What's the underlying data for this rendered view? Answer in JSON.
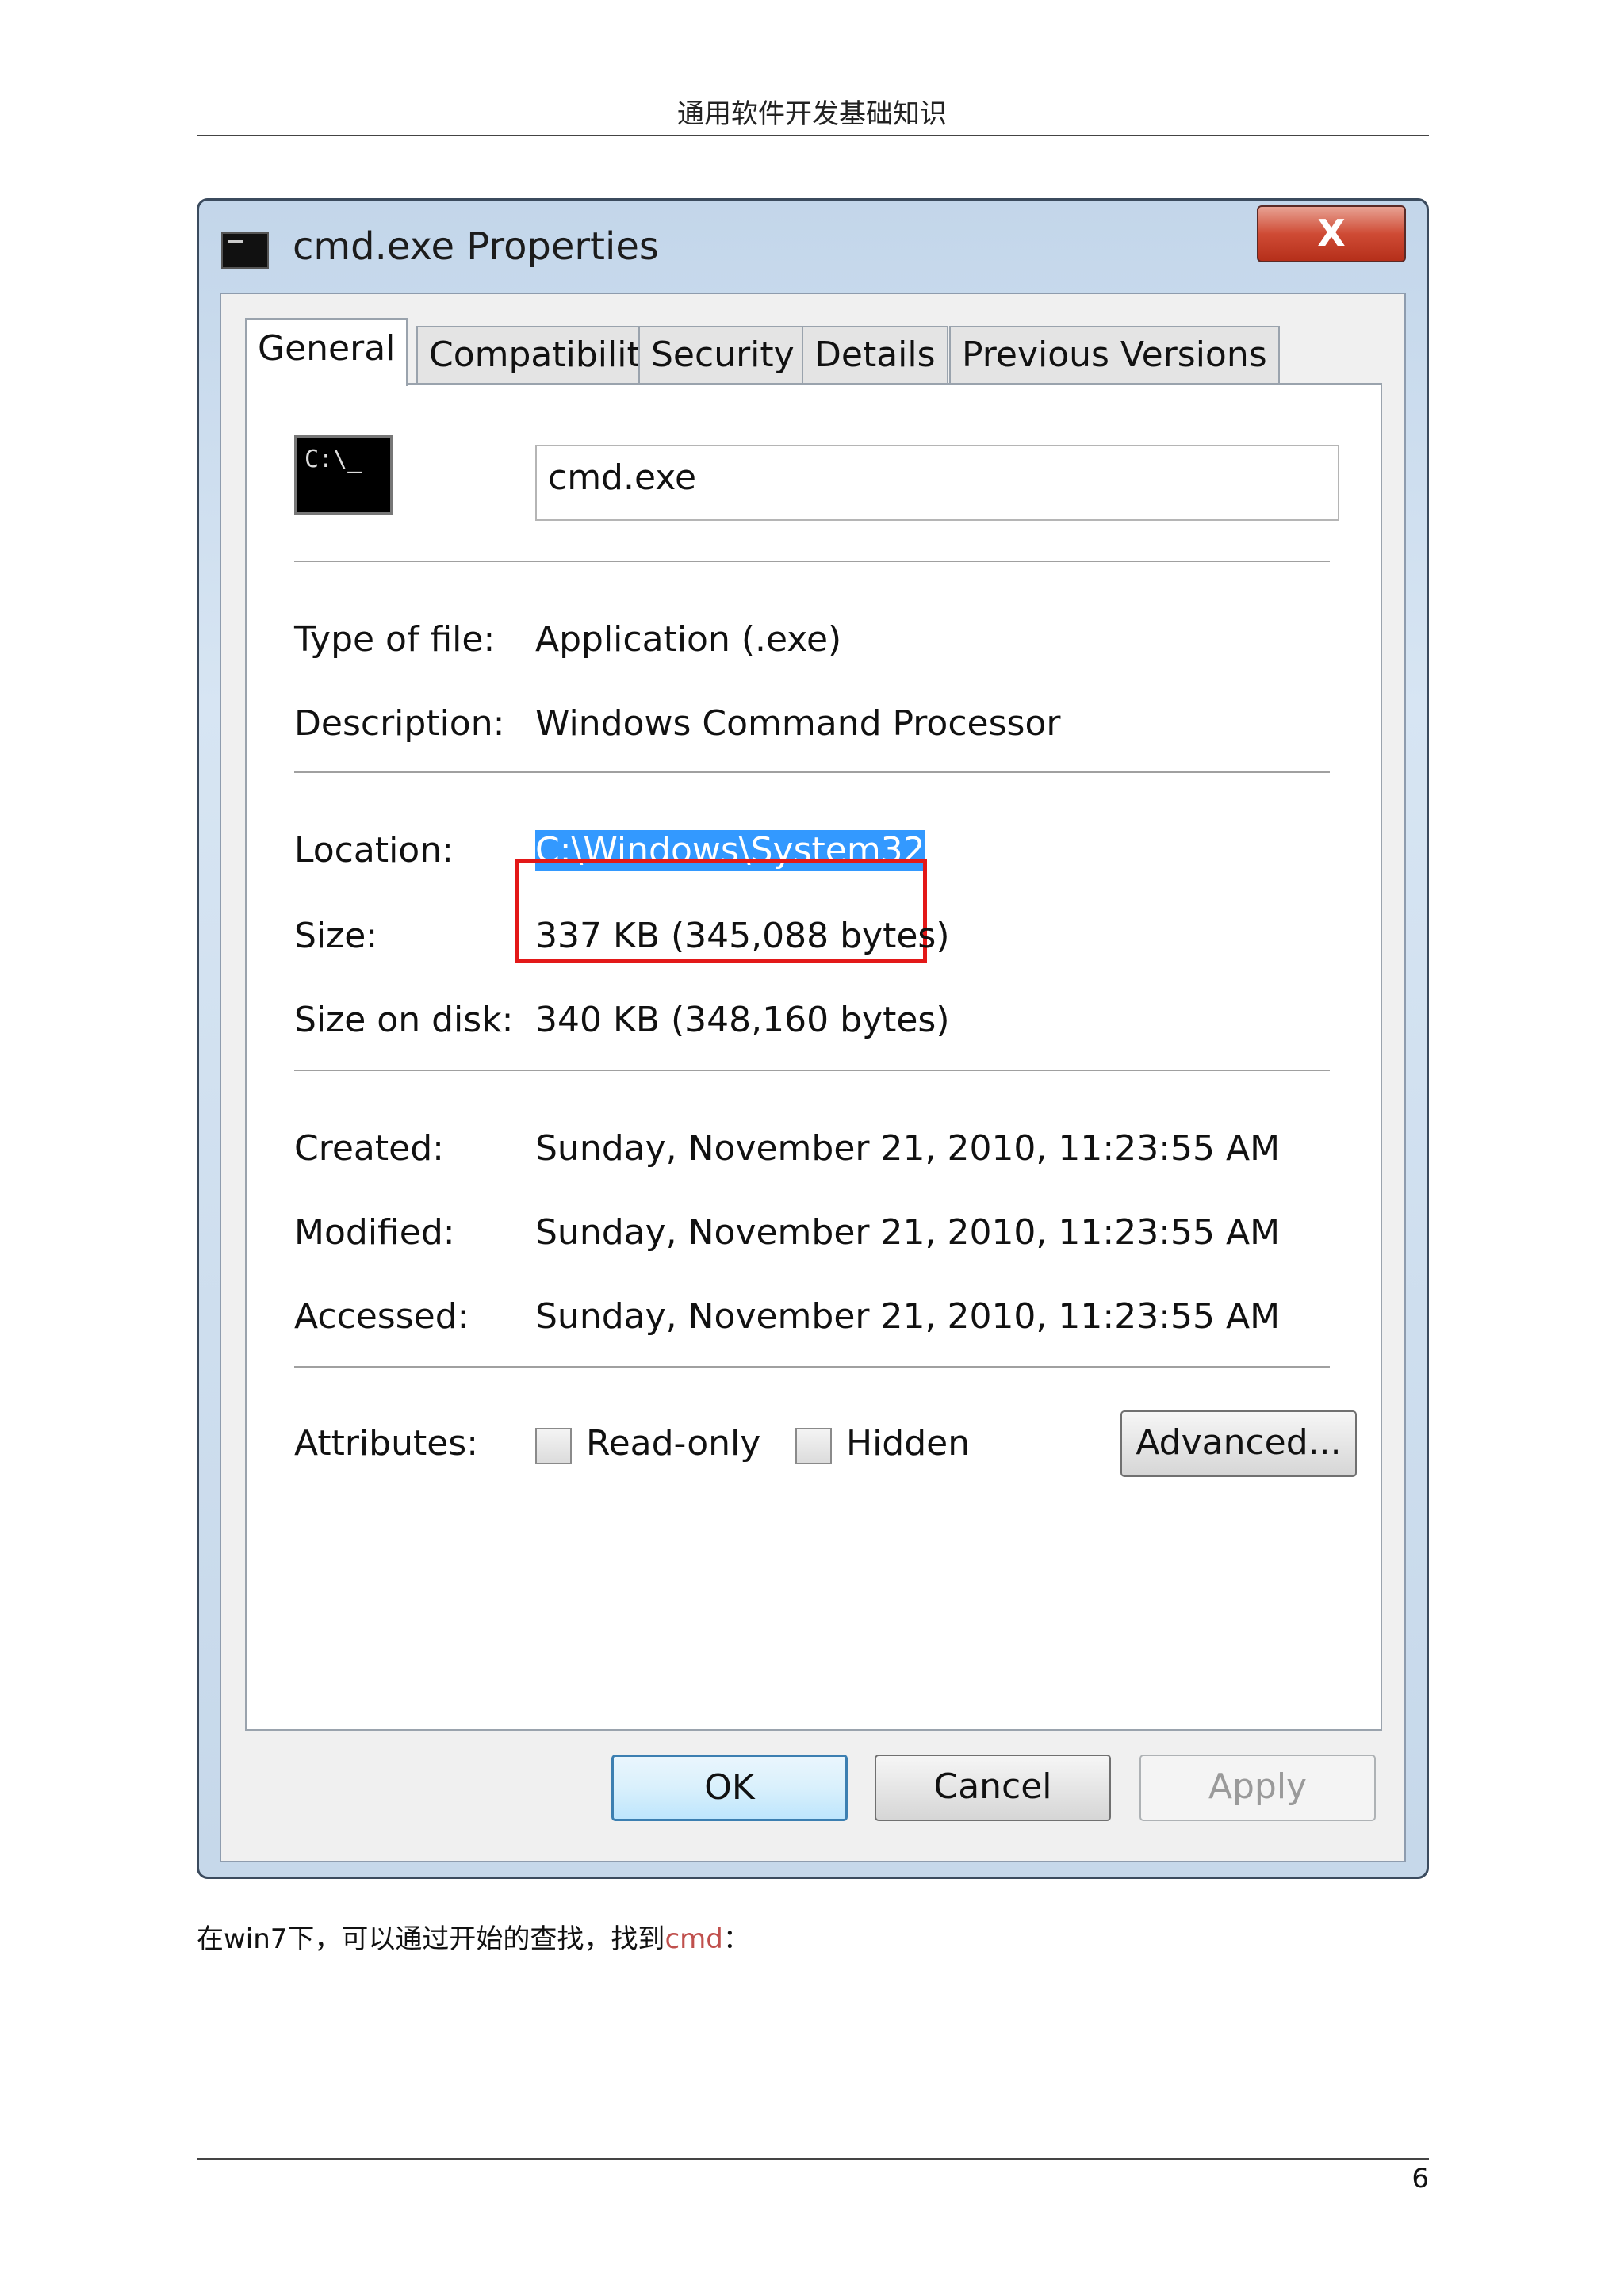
{
  "page": {
    "header": "通用软件开发基础知识",
    "caption_before": "在win7下，可以通过开始的查找，找到",
    "caption_keyword": "cmd",
    "caption_after": "：",
    "page_number": "6"
  },
  "window": {
    "title": "cmd.exe Properties",
    "close_label": "X",
    "icon": "command-prompt-icon"
  },
  "tabs": [
    {
      "label": "General",
      "active": true
    },
    {
      "label": "Compatibility",
      "active": false
    },
    {
      "label": "Security",
      "active": false
    },
    {
      "label": "Details",
      "active": false
    },
    {
      "label": "Previous Versions",
      "active": false
    }
  ],
  "general": {
    "file_icon_text": "C:\\_",
    "file_name": "cmd.exe",
    "type_label": "Type of file:",
    "type_value": "Application (.exe)",
    "description_label": "Description:",
    "description_value": "Windows Command Processor",
    "location_label": "Location:",
    "location_value": "C:\\Windows\\System32",
    "size_label": "Size:",
    "size_value": "337 KB (345,088 bytes)",
    "size_on_disk_label": "Size on disk:",
    "size_on_disk_value": "340 KB (348,160 bytes)",
    "created_label": "Created:",
    "created_value": "Sunday, November 21, 2010, 11:23:55 AM",
    "modified_label": "Modified:",
    "modified_value": "Sunday, November 21, 2010, 11:23:55 AM",
    "accessed_label": "Accessed:",
    "accessed_value": "Sunday, November 21, 2010, 11:23:55 AM",
    "attributes_label": "Attributes:",
    "readonly_label": "Read-only",
    "readonly_checked": false,
    "hidden_label": "Hidden",
    "hidden_checked": false,
    "advanced_label": "Advanced..."
  },
  "buttons": {
    "ok": "OK",
    "cancel": "Cancel",
    "apply": "Apply"
  },
  "colors": {
    "selection": "#3399ff",
    "highlight_box": "#e31818",
    "caption_keyword": "#c0504d"
  }
}
